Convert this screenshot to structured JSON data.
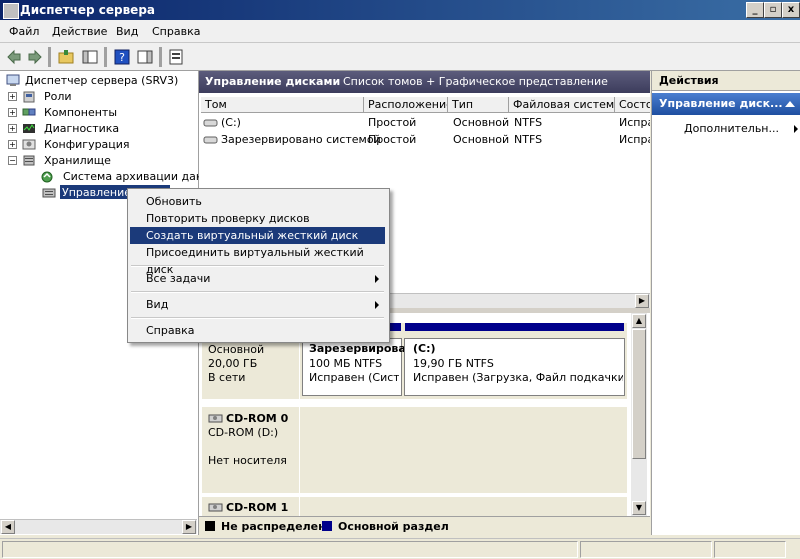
{
  "window": {
    "title": "Диспетчер сервера"
  },
  "titlebar_buttons": [
    "_",
    "▫",
    "x"
  ],
  "menu": [
    "Файл",
    "Действие",
    "Вид",
    "Справка"
  ],
  "tree": {
    "root": "Диспетчер сервера (SRV3)",
    "items": [
      {
        "label": "Роли",
        "icon": "roles-icon"
      },
      {
        "label": "Компоненты",
        "icon": "features-icon"
      },
      {
        "label": "Диагностика",
        "icon": "diagnostics-icon"
      },
      {
        "label": "Конфигурация",
        "icon": "configuration-icon"
      },
      {
        "label": "Хранилище",
        "icon": "storage-icon"
      },
      {
        "label": "Система архивации данн",
        "icon": "backup-icon"
      },
      {
        "label": "Управление",
        "icon": "disk-management-icon"
      }
    ]
  },
  "center": {
    "title": "Управление дисками",
    "subtitle": "Список томов + Графическое представление",
    "columns": [
      "Том",
      "Расположение",
      "Тип",
      "Файловая система",
      "Состо"
    ],
    "rows": [
      [
        "(C:)",
        "Простой",
        "Основной",
        "NTFS",
        "Испра"
      ],
      [
        "Зарезервировано системой",
        "Простой",
        "Основной",
        "NTFS",
        "Испра"
      ]
    ]
  },
  "disks": {
    "disk0": {
      "type": "Основной",
      "size": "20,00 ГБ",
      "status": "В сети"
    },
    "volumes": [
      {
        "name": "Зарезервирова",
        "size": "100 МБ NTFS",
        "status": "Исправен (Систем"
      },
      {
        "name": "(C:)",
        "size": "19,90 ГБ NTFS",
        "status": "Исправен (Загрузка, Файл подкачки, Ава"
      }
    ],
    "cdrom0": {
      "name": "CD-ROM 0",
      "drive": "CD-ROM (D:)",
      "status": "Нет носителя"
    },
    "cdrom1": {
      "name": "CD-ROM 1"
    },
    "legend": [
      "Не распределен",
      "Основной раздел"
    ]
  },
  "actions": {
    "header": "Действия",
    "section": "Управление диск...",
    "more": "Дополнительн..."
  },
  "context_menu": {
    "items": [
      "Обновить",
      "Повторить проверку дисков",
      "Создать виртуальный жесткий диск",
      "Присоединить виртуальный жесткий диск",
      "Все задачи",
      "Вид",
      "Справка"
    ],
    "selected_index": 2
  },
  "colors": {
    "accent": "#0a246a",
    "volume_bar": "#00008b",
    "selection": "#1b3a7a"
  }
}
